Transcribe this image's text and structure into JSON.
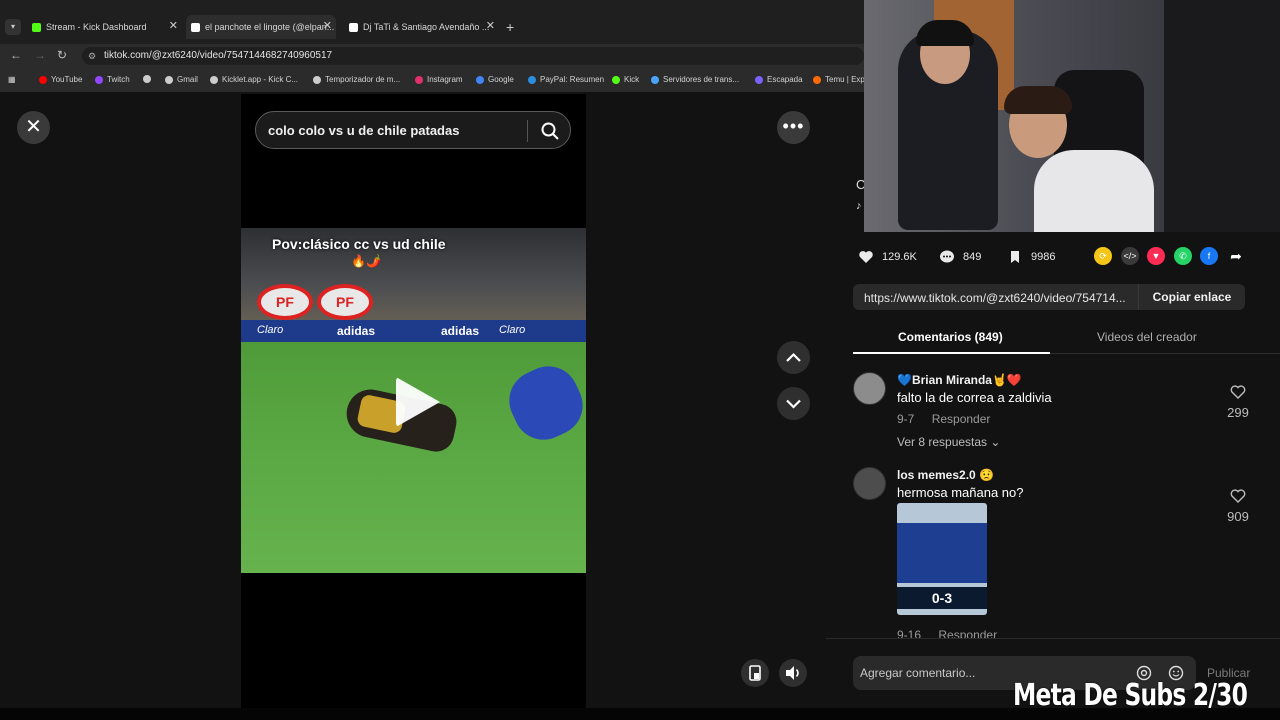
{
  "browser": {
    "tabs": [
      {
        "label": "Stream - Kick Dashboard",
        "color": "#53fc18"
      },
      {
        "label": "el panchote el lingote (@elpan...",
        "color": "#ffffff"
      },
      {
        "label": "Dj TaTi & Santiago Avendaño ...",
        "color": "#ffffff"
      }
    ],
    "new_tab": "+",
    "url": "tiktok.com/@zxt6240/video/7547144682740960517",
    "bookmarks": [
      {
        "label": "YouTube",
        "color": "#ff0000"
      },
      {
        "label": "Twitch",
        "color": "#9146ff"
      },
      {
        "label": "",
        "color": "#cccccc"
      },
      {
        "label": "Gmail",
        "color": "#cccccc"
      },
      {
        "label": "Kicklet.app - Kick C...",
        "color": "#cccccc"
      },
      {
        "label": "Temporizador de m...",
        "color": "#cccccc"
      },
      {
        "label": "Instagram",
        "color": "#e1306c"
      },
      {
        "label": "Google",
        "color": "#4285f4"
      },
      {
        "label": "PayPal: Resumen",
        "color": "#2c8ee0"
      },
      {
        "label": "Kick",
        "color": "#53fc18"
      },
      {
        "label": "Servidores de trans...",
        "color": "#4aa3ff"
      },
      {
        "label": "Escapada",
        "color": "#7b61ff"
      },
      {
        "label": "Temu | Exp",
        "color": "#ff6a00"
      }
    ]
  },
  "search": {
    "query": "colo colo vs u de chile patadas"
  },
  "video": {
    "overlay_text": "Pov:clásico cc vs ud chile",
    "overlay_emoji": "🔥🌶️",
    "sponsor_pf": "PF",
    "sponsor_adidas": "adidas",
    "sponsor_claro": "Claro"
  },
  "actions": {
    "likes": "129.6K",
    "comments": "849",
    "saves": "9986",
    "share_colors": [
      "#f5c518",
      "#3a3a3a",
      "#fe2c55",
      "#25d366",
      "#1877f2"
    ]
  },
  "link": {
    "url": "https://www.tiktok.com/@zxt6240/video/754714...",
    "copy_label": "Copiar enlace"
  },
  "comment_tabs": {
    "comments": "Comentarios (849)",
    "creator_videos": "Videos del creador"
  },
  "comments": [
    {
      "name": "💙Brian Miranda🤘❤️",
      "text": "falto la de correa a zaldivia",
      "date": "9-7",
      "reply": "Responder",
      "view_replies": "Ver 8 respuestas",
      "likes": "299"
    },
    {
      "name": "los memes2.0 😟",
      "text": "hermosa mañana no?",
      "date": "9-16",
      "reply": "Responder",
      "likes": "909",
      "thumb_score": "0-3"
    }
  ],
  "add_comment": {
    "placeholder": "Agregar comentario...",
    "publish": "Publicar"
  },
  "stream_overlay": {
    "goal": "Meta De Subs 2/30"
  },
  "partial_text": {
    "c": "C",
    "n": "♪"
  }
}
